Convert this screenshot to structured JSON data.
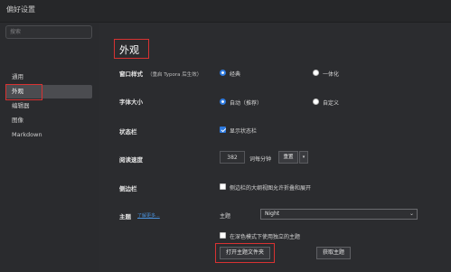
{
  "window": {
    "title": "偏好设置"
  },
  "sidebar": {
    "search_placeholder": "搜索",
    "items": [
      {
        "label": "通用"
      },
      {
        "label": "外观"
      },
      {
        "label": "编辑器"
      },
      {
        "label": "图像"
      },
      {
        "label": "Markdown"
      }
    ],
    "active_item": "外观"
  },
  "main": {
    "heading": "外观",
    "window_style": {
      "label": "窗口样式",
      "note": "（重启 Typora 后生效）",
      "options": [
        {
          "label": "经典",
          "selected": true
        },
        {
          "label": "一体化",
          "selected": false
        }
      ]
    },
    "font_size": {
      "label": "字体大小",
      "options": [
        {
          "label": "自动（推荐）",
          "selected": true
        },
        {
          "label": "自定义",
          "selected": false
        }
      ]
    },
    "status_bar": {
      "label": "状态栏",
      "checkbox_label": "显示状态栏",
      "checked": true
    },
    "reading_speed": {
      "label": "阅读速度",
      "value": "382",
      "unit": "词每分钟",
      "reset_label": "重置",
      "caret": "▾"
    },
    "sidebar_setting": {
      "label": "侧边栏",
      "checkbox_label": "侧边栏的大纲视图允许折叠和展开",
      "checked": false
    },
    "theme": {
      "label": "主题",
      "learn_more": "了解更多...",
      "select_label": "主题",
      "selected_theme": "Night",
      "caret": "⌄",
      "dark_mode_checkbox_label": "在深色模式下使用独立的主题",
      "dark_mode_checked": false,
      "open_folder_button": "打开主题文件夹",
      "get_theme_button": "获取主题"
    }
  },
  "colors": {
    "accent": "#2f7be0",
    "highlight_box": "#d83232",
    "background": "#2b2c2f",
    "active_nav": "#4b4c50"
  }
}
